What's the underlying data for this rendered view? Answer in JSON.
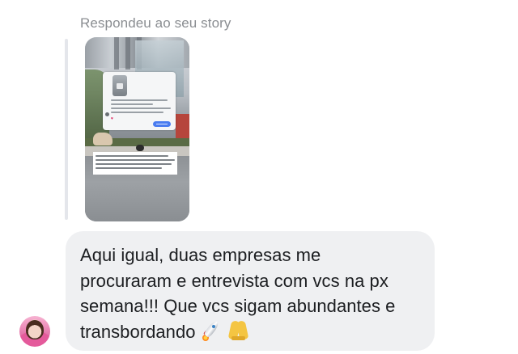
{
  "reply_caption": "Respondeu ao seu story",
  "story": {
    "thumbnail_icon": "story-screenshot-image"
  },
  "message": {
    "text": "Aqui igual, duas empresas me\nprocuraram e entrevista com vcs na px\nsemana!!! Que vcs sigam abundantes e\ntransbordando",
    "emojis": [
      "rocket-emoji",
      "folded-hands-emoji"
    ]
  },
  "sender": {
    "avatar_icon": "user-avatar"
  },
  "colors": {
    "bubble_bg": "#eff0f2",
    "text": "#1c1e21",
    "caption": "#8a8d91"
  }
}
